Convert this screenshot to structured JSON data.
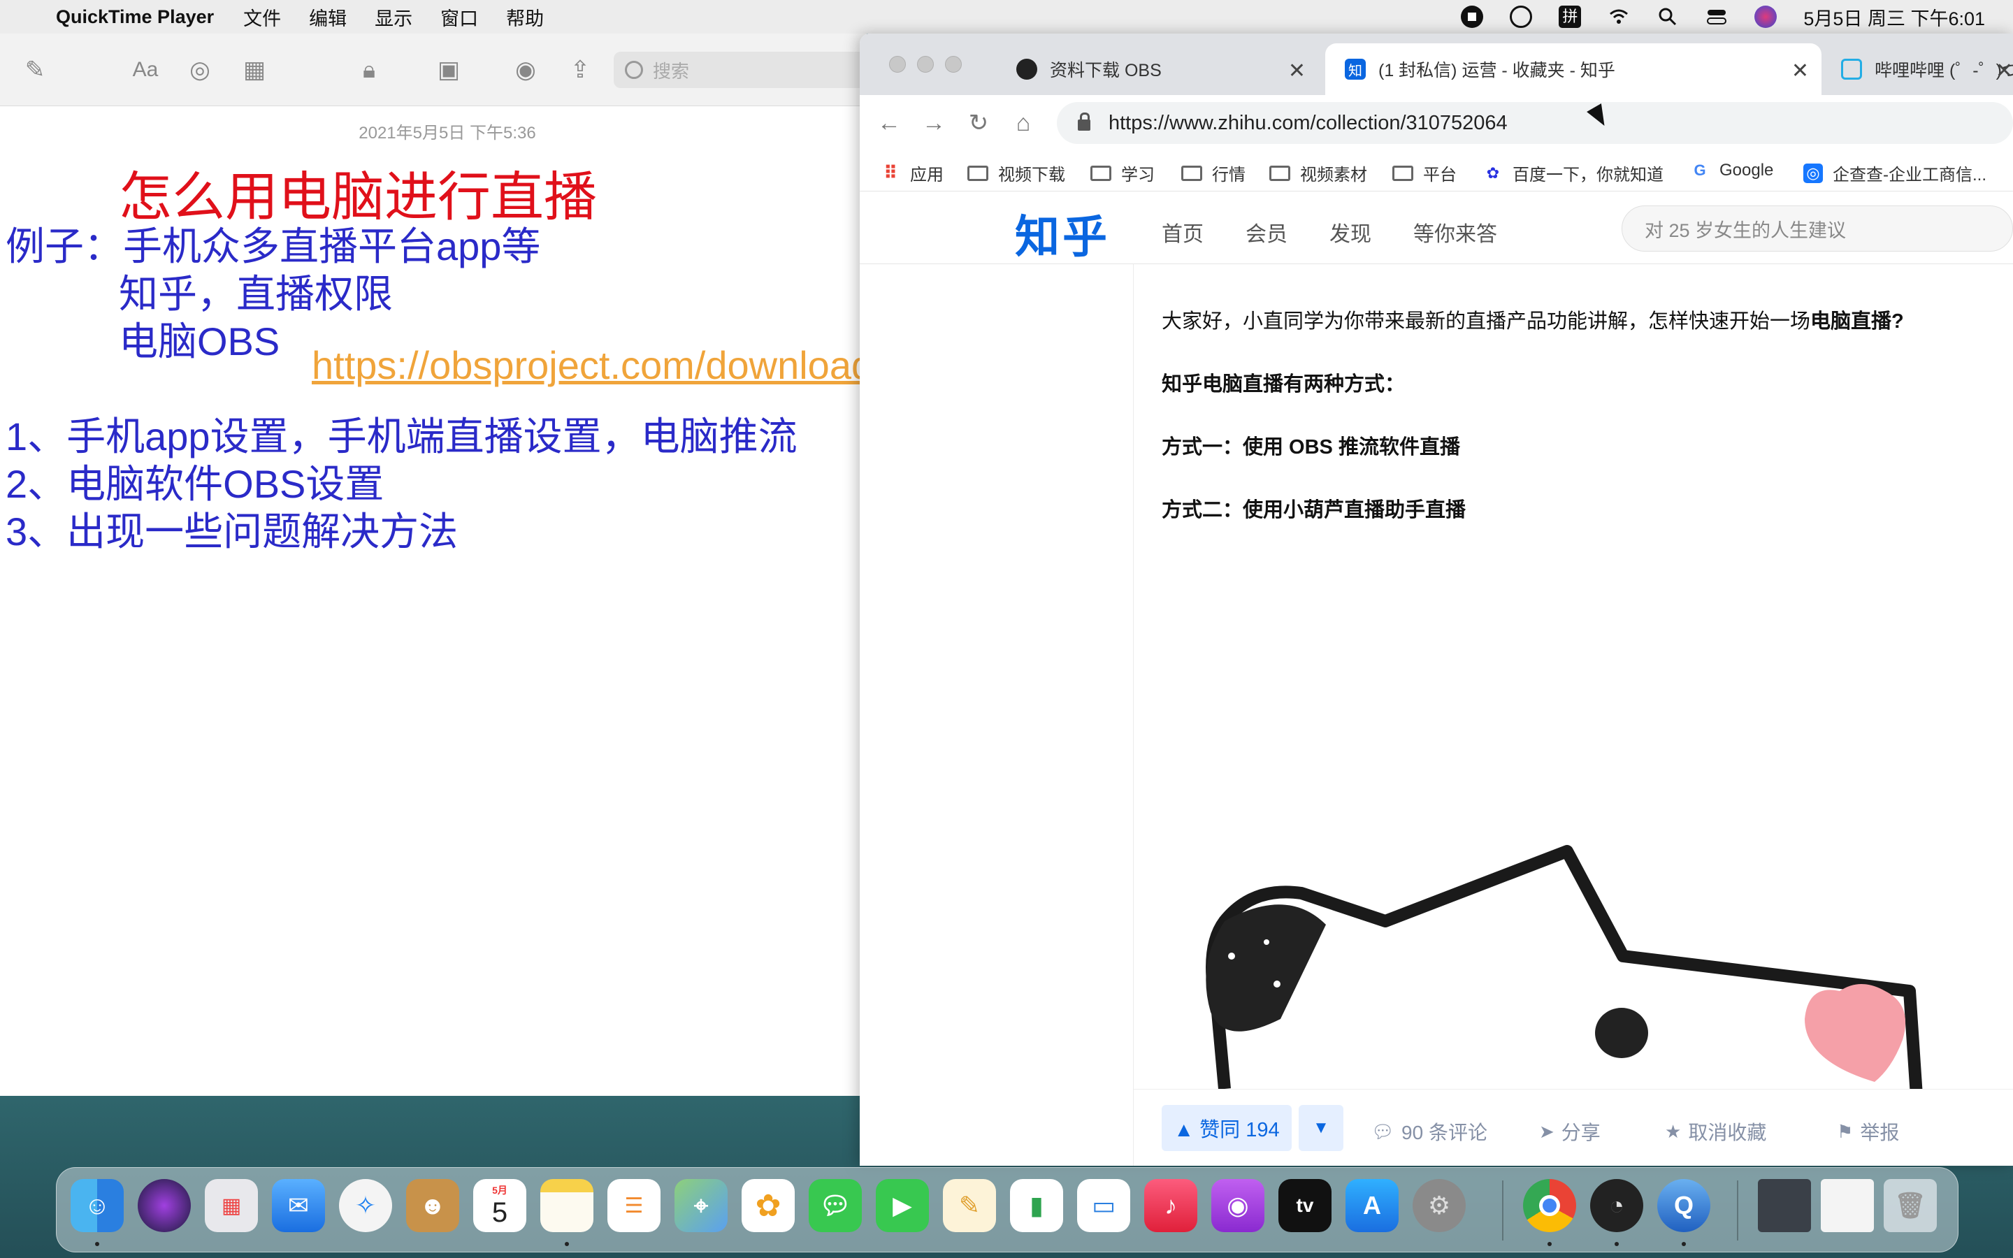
{
  "menubar": {
    "app_name": "QuickTime Player",
    "menus": [
      "文件",
      "编辑",
      "显示",
      "窗口",
      "帮助"
    ],
    "clock": "5月5日 周三 下午6:01"
  },
  "notes": {
    "search_placeholder": "搜索",
    "date": "2021年5月5日 下午5:36",
    "title": "怎么用电脑进行直播",
    "lines": [
      "例子：手机众多直播平台app等",
      "知乎，直播权限",
      "电脑OBS",
      "1、手机app设置，手机端直播设置，电脑推流",
      "2、电脑软件OBS设置",
      "3、出现一些问题解决方法"
    ],
    "link": "https://obsproject.com/download"
  },
  "browser": {
    "tabs": [
      {
        "label": "资料下载 OBS",
        "active": false
      },
      {
        "label": "(1 封私信) 运营 - 收藏夹 - 知乎",
        "active": true
      },
      {
        "label": "哔哩哔哩 (゜-゜)つロ 干杯~-bilibili",
        "active": false
      }
    ],
    "url": "https://www.zhihu.com/collection/310752064",
    "bookmarks": [
      "应用",
      "视频下载",
      "学习",
      "行情",
      "视频素材",
      "平台",
      "百度一下，你就知道",
      "Google",
      "企查查-企业工商信..."
    ]
  },
  "zhihu": {
    "logo": "知乎",
    "nav": [
      "首页",
      "会员",
      "发现",
      "等你来答"
    ],
    "search_placeholder": "对 25 岁女生的人生建议",
    "intro": "大家好，小直同学为你带来最新的直播产品功能讲解，怎样快速开始一场",
    "intro_bold": "电脑直播?",
    "heading": "知乎电脑直播有两种方式：",
    "method1": "方式一：使用 OBS 推流软件直播",
    "method2": "方式二：使用小葫芦直播助手直播",
    "actions": {
      "vote": "▲ 赞同 194",
      "vote_down": "▼",
      "comments": "90 条评论",
      "share": "分享",
      "unfavorite": "取消收藏",
      "report": "举报"
    }
  },
  "dock": {
    "calendar_month": "5月",
    "calendar_day": "5",
    "tv_label": "tv"
  }
}
